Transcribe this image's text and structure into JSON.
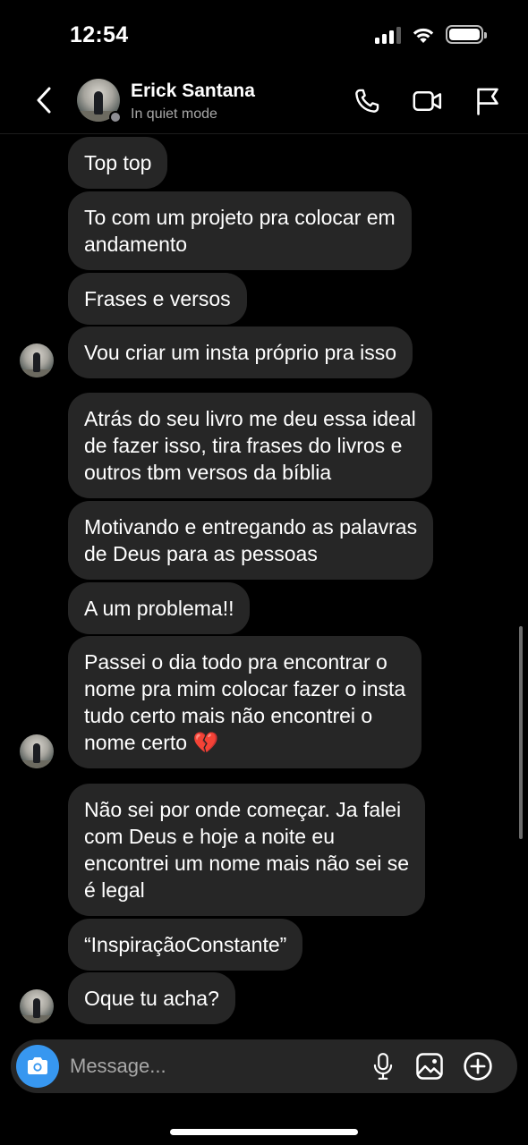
{
  "status_bar": {
    "time": "12:54",
    "battery_level": 1.0
  },
  "header": {
    "contact_name": "Erick Santana",
    "contact_status": "In quiet mode",
    "icons": [
      "back-chevron-icon",
      "phone-icon",
      "video-icon",
      "flag-icon"
    ]
  },
  "messages": [
    {
      "lines": [
        "Top top"
      ]
    },
    {
      "lines": [
        "To com um projeto pra colocar em",
        "andamento"
      ]
    },
    {
      "lines": [
        "Frases e versos"
      ]
    },
    {
      "lines": [
        "Vou criar um insta próprio pra isso"
      ]
    },
    {
      "lines": [
        "Atrás do seu livro me deu essa ideal",
        "de fazer isso, tira frases do livros e",
        "outros tbm versos da bíblia"
      ]
    },
    {
      "lines": [
        "Motivando e entregando as palavras",
        "de Deus para as pessoas"
      ]
    },
    {
      "lines": [
        "A um problema!!"
      ]
    },
    {
      "lines": [
        "Passei o dia todo pra encontrar o",
        "nome pra mim colocar fazer o insta",
        "tudo certo mais não encontrei o",
        "nome certo 💔"
      ]
    },
    {
      "lines": [
        "Não sei por onde começar. Ja falei",
        "com Deus e hoje a noite eu",
        "encontrei um nome mais não sei se",
        "é legal"
      ]
    },
    {
      "lines": [
        "“InspiraçãoConstante”"
      ]
    },
    {
      "lines": [
        "Oque tu acha?"
      ]
    }
  ],
  "composer": {
    "placeholder": "Message...",
    "icons": [
      "camera-icon",
      "microphone-icon",
      "gallery-icon",
      "add-circle-icon"
    ]
  },
  "colors": {
    "background": "#000000",
    "bubble": "#262626",
    "accent": "#3797f0",
    "secondary_text": "#a8a8a8"
  }
}
